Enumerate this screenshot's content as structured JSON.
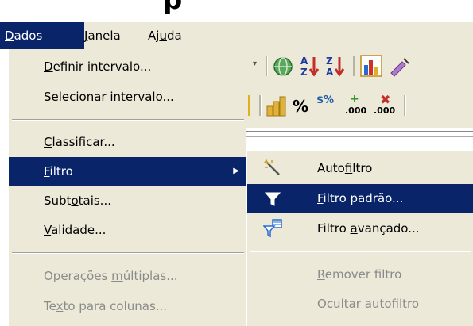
{
  "title_fragment": "p",
  "menubar": {
    "items": [
      {
        "pre": "",
        "key": "D",
        "post": "ados"
      },
      {
        "pre": "",
        "key": "J",
        "post": "anela"
      },
      {
        "pre": "Aj",
        "key": "u",
        "post": "da"
      }
    ]
  },
  "menu": {
    "items": [
      {
        "pre": "",
        "key": "D",
        "post": "efinir intervalo..."
      },
      {
        "pre": "Selecionar ",
        "key": "i",
        "post": "ntervalo..."
      },
      {
        "pre": "",
        "key": "C",
        "post": "lassificar..."
      },
      {
        "pre": "",
        "key": "F",
        "post": "iltro"
      },
      {
        "pre": "Subt",
        "key": "o",
        "post": "tais..."
      },
      {
        "pre": "",
        "key": "V",
        "post": "alidade..."
      },
      {
        "pre": "Operações ",
        "key": "m",
        "post": "últiplas..."
      },
      {
        "pre": "Te",
        "key": "x",
        "post": "to para colunas..."
      }
    ]
  },
  "submenu": {
    "items": [
      {
        "pre": "Auto",
        "key": "f",
        "post": "iltro",
        "icon": "autofilter-wand-icon"
      },
      {
        "pre": "",
        "key": "F",
        "post": "iltro padrão...",
        "icon": "funnel-icon"
      },
      {
        "pre": "Filtro ",
        "key": "a",
        "post": "vançado...",
        "icon": "advanced-filter-icon"
      },
      {
        "pre": "",
        "key": "R",
        "post": "emover filtro"
      },
      {
        "pre": "",
        "key": "O",
        "post": "cultar autofiltro"
      }
    ]
  },
  "toolbar": {
    "percent_label": "%",
    "currency_label": "$%",
    "add_decimal_label": ".000",
    "del_decimal_label": ".000"
  },
  "colors": {
    "menu_bg": "#ece9d8",
    "selection": "#0a246a",
    "disabled_text": "#8a8a8a"
  }
}
